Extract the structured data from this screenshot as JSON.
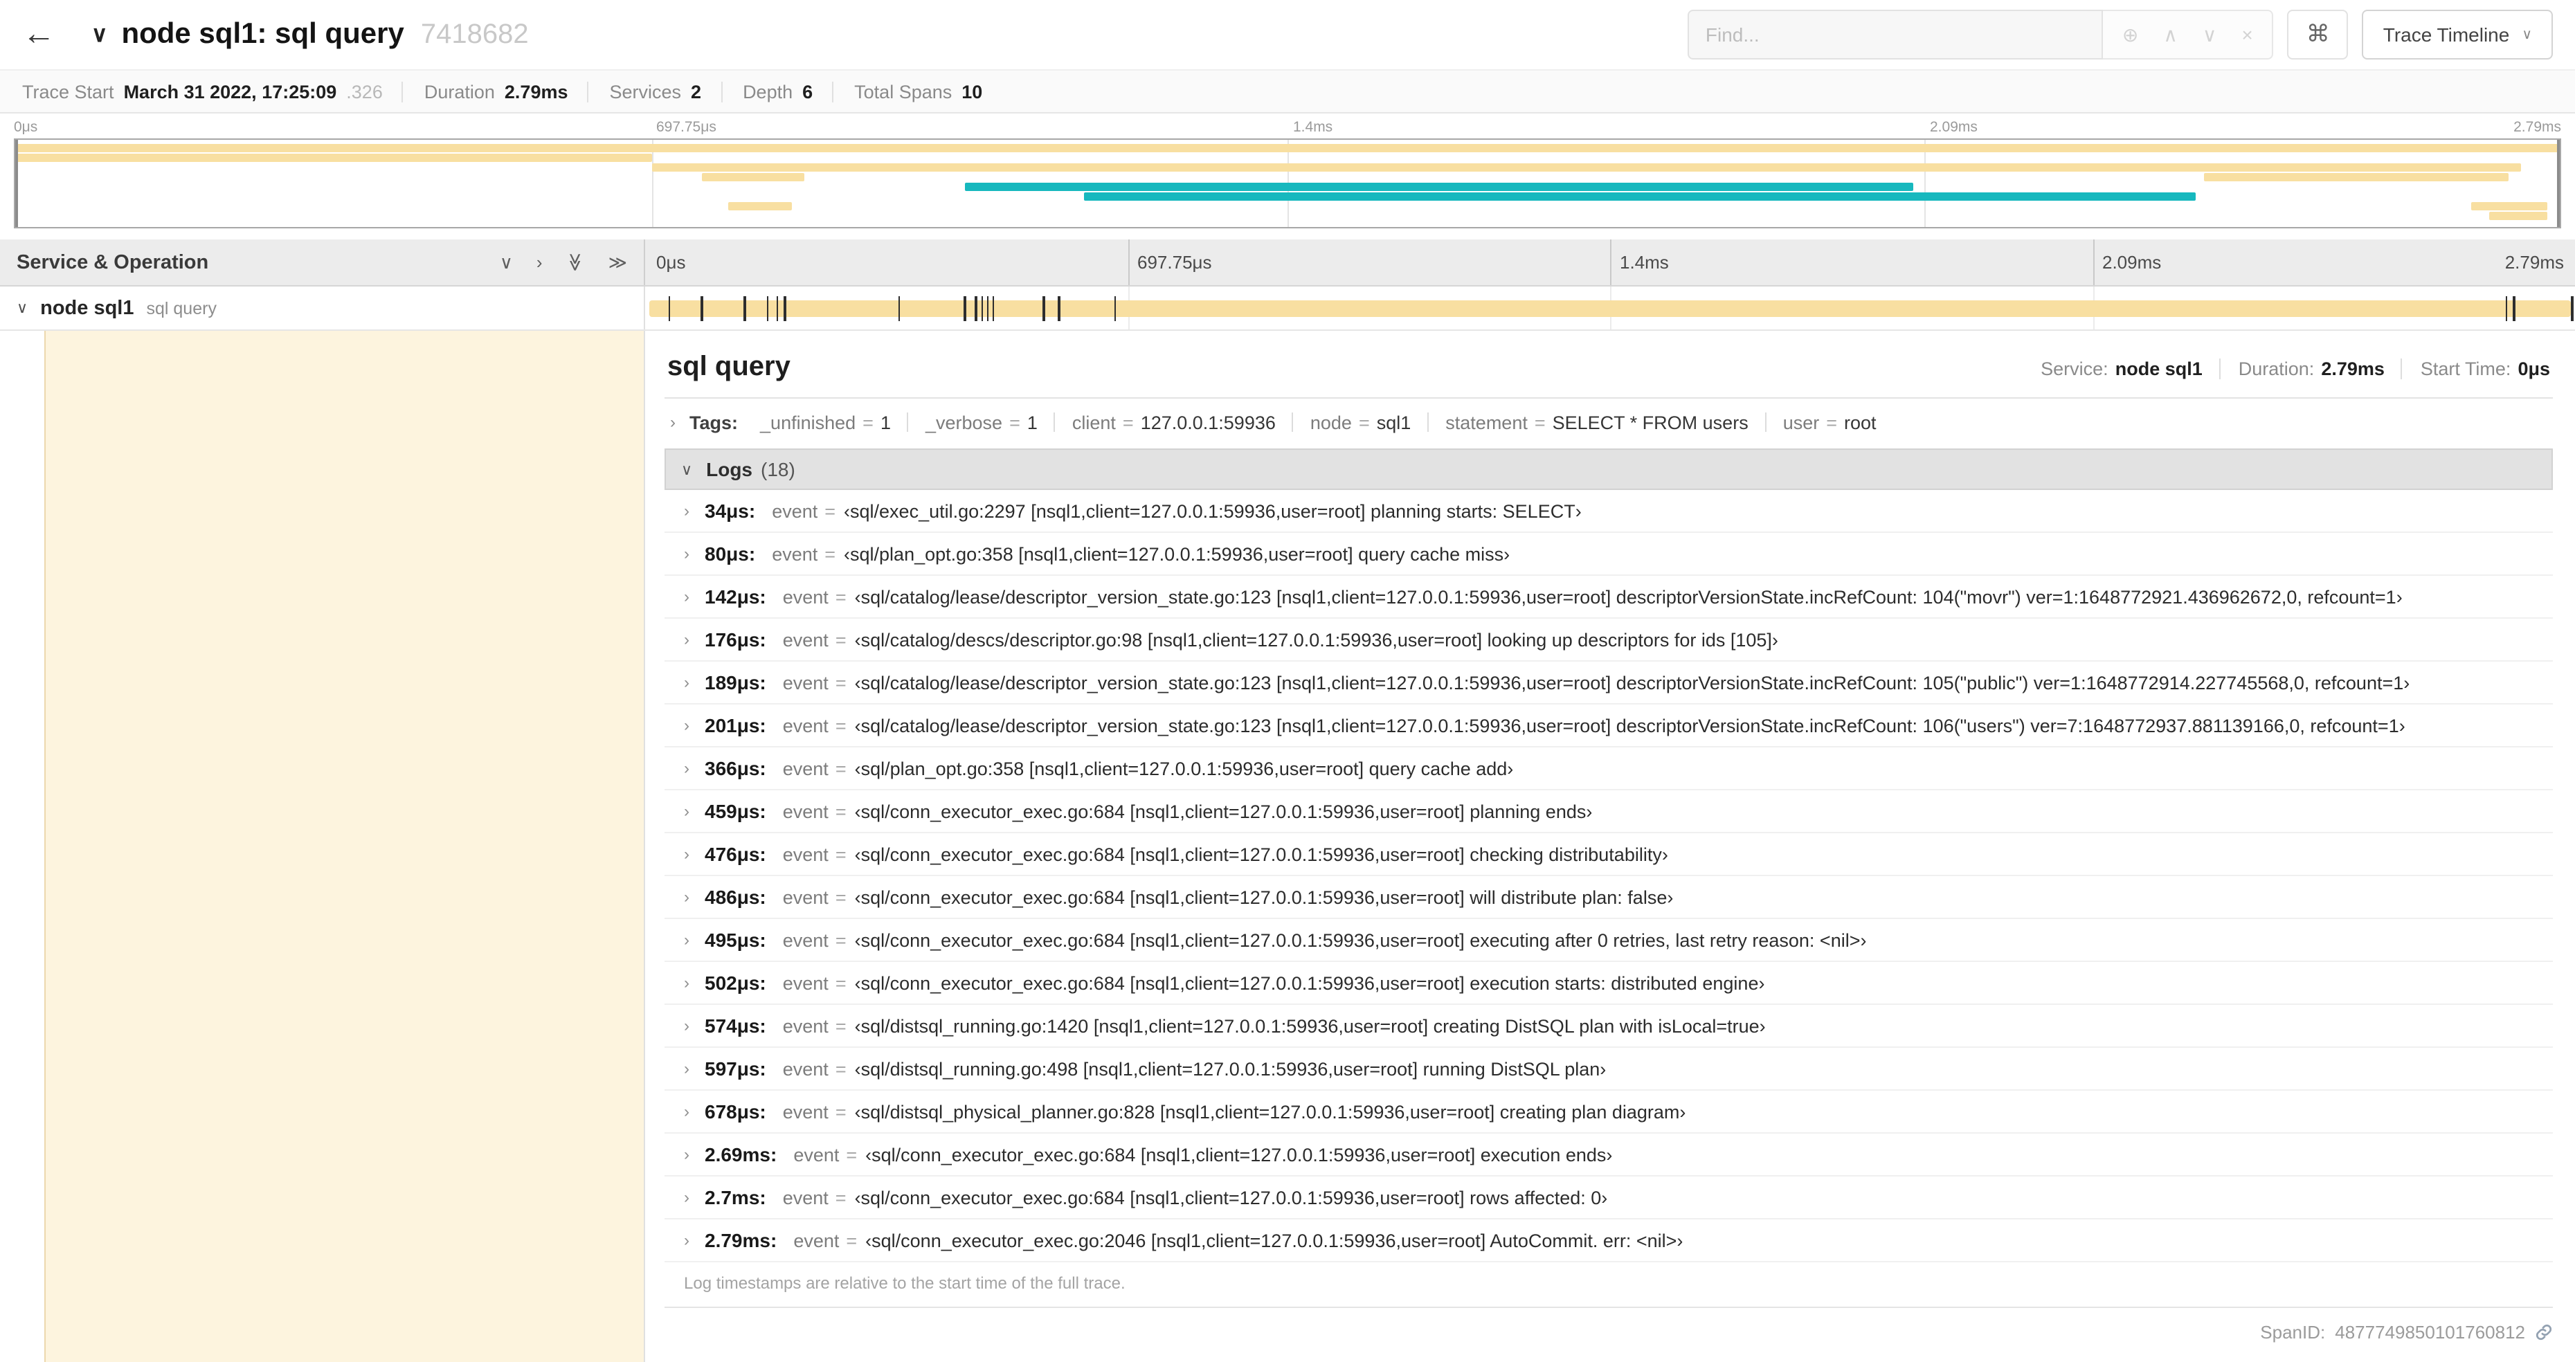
{
  "colors": {
    "span_tan": "#F8DFA1",
    "span_teal": "#17B8BE",
    "detail_row_fill": "rgba(248,223,161,0.35)"
  },
  "icons": {
    "back": "←",
    "title_collapser": "∨",
    "find_zoom": "⊕",
    "find_prev": "∧",
    "find_next": "∨",
    "find_clear": "×",
    "shortcuts": "⌘",
    "view_chevron": "∨",
    "collapse_one": "∨",
    "expand_one": "›",
    "collapse_all": "≫",
    "expand_all": "≫",
    "row_collapser": "∨",
    "tags_chevron": "›",
    "logs_chevron": "∨",
    "log_chevron": "›"
  },
  "header": {
    "title": "node sql1: sql query",
    "trace_id": "7418682",
    "find": {
      "placeholder": "Find..."
    },
    "view_button": {
      "label": "Trace Timeline"
    }
  },
  "trace_info": [
    {
      "label": "Trace Start",
      "value": "March 31 2022, 17:25:09",
      "suffix": ".326"
    },
    {
      "label": "Duration",
      "value": "2.79ms"
    },
    {
      "label": "Services",
      "value": "2"
    },
    {
      "label": "Depth",
      "value": "6"
    },
    {
      "label": "Total Spans",
      "value": "10"
    }
  ],
  "minimap": {
    "axis_labels": [
      {
        "text": "0μs",
        "pct": 0
      },
      {
        "text": "697.75μs",
        "pct": 25
      },
      {
        "text": "1.4ms",
        "pct": 50
      },
      {
        "text": "2.09ms",
        "pct": 75
      },
      {
        "text": "2.79ms",
        "pct": 100
      }
    ],
    "gridlines_pct": [
      25,
      50,
      75
    ],
    "bars": [
      {
        "row": 0,
        "start_pct": 0,
        "width_pct": 100,
        "color": "tan"
      },
      {
        "row": 1,
        "start_pct": 0,
        "width_pct": 25,
        "color": "tan"
      },
      {
        "row": 2,
        "start_pct": 25,
        "width_pct": 73.5,
        "color": "tan"
      },
      {
        "row": 3,
        "start_pct": 27,
        "width_pct": 4,
        "color": "tan"
      },
      {
        "row": 3,
        "start_pct": 86,
        "width_pct": 12,
        "color": "tan"
      },
      {
        "row": 4,
        "start_pct": 37.3,
        "width_pct": 37.3,
        "color": "teal"
      },
      {
        "row": 5,
        "start_pct": 42,
        "width_pct": 43.7,
        "color": "teal"
      },
      {
        "row": 6,
        "start_pct": 28,
        "width_pct": 2.5,
        "color": "tan"
      },
      {
        "row": 6,
        "start_pct": 96.5,
        "width_pct": 3,
        "color": "tan"
      },
      {
        "row": 7,
        "start_pct": 97.2,
        "width_pct": 2.3,
        "color": "tan"
      }
    ]
  },
  "timeline": {
    "left_header": "Service & Operation",
    "columns": [
      {
        "text": "0μs",
        "pct": 0
      },
      {
        "text": "697.75μs",
        "pct": 25
      },
      {
        "text": "1.4ms",
        "pct": 50
      },
      {
        "text": "2.09ms",
        "pct": 75
      },
      {
        "text": "2.79ms",
        "pct": 100
      }
    ],
    "row": {
      "service": "node sql1",
      "operation": "sql query",
      "bar_start_pct": 0.2,
      "bar_width_pct": 99.6,
      "tick_pcts": [
        1.2,
        2.9,
        5.1,
        6.3,
        6.8,
        7.2,
        13.1,
        16.5,
        17.1,
        17.4,
        17.7,
        18.0,
        20.6,
        21.4,
        24.3,
        96.4,
        96.8,
        99.8
      ]
    }
  },
  "detail": {
    "title": "sql query",
    "meta": [
      {
        "label": "Service:",
        "value": "node sql1"
      },
      {
        "label": "Duration:",
        "value": "2.79ms"
      },
      {
        "label": "Start Time:",
        "value": "0μs"
      }
    ],
    "tags": {
      "label": "Tags:",
      "pairs": [
        {
          "key": "_unfinished",
          "value": "1"
        },
        {
          "key": "_verbose",
          "value": "1"
        },
        {
          "key": "client",
          "value": "127.0.0.1:59936"
        },
        {
          "key": "node",
          "value": "sql1"
        },
        {
          "key": "statement",
          "value": "SELECT * FROM users"
        },
        {
          "key": "user",
          "value": "root"
        }
      ]
    },
    "logs": {
      "label": "Logs",
      "count": "(18)",
      "entries": [
        {
          "time": "34μs:",
          "key": "event",
          "value": "‹sql/exec_util.go:2297 [nsql1,client=127.0.0.1:59936,user=root] planning starts: SELECT›"
        },
        {
          "time": "80μs:",
          "key": "event",
          "value": "‹sql/plan_opt.go:358 [nsql1,client=127.0.0.1:59936,user=root] query cache miss›"
        },
        {
          "time": "142μs:",
          "key": "event",
          "value": "‹sql/catalog/lease/descriptor_version_state.go:123 [nsql1,client=127.0.0.1:59936,user=root] descriptorVersionState.incRefCount: 104(\"movr\") ver=1:1648772921.436962672,0, refcount=1›"
        },
        {
          "time": "176μs:",
          "key": "event",
          "value": "‹sql/catalog/descs/descriptor.go:98 [nsql1,client=127.0.0.1:59936,user=root] looking up descriptors for ids [105]›"
        },
        {
          "time": "189μs:",
          "key": "event",
          "value": "‹sql/catalog/lease/descriptor_version_state.go:123 [nsql1,client=127.0.0.1:59936,user=root] descriptorVersionState.incRefCount: 105(\"public\") ver=1:1648772914.227745568,0, refcount=1›"
        },
        {
          "time": "201μs:",
          "key": "event",
          "value": "‹sql/catalog/lease/descriptor_version_state.go:123 [nsql1,client=127.0.0.1:59936,user=root] descriptorVersionState.incRefCount: 106(\"users\") ver=7:1648772937.881139166,0, refcount=1›"
        },
        {
          "time": "366μs:",
          "key": "event",
          "value": "‹sql/plan_opt.go:358 [nsql1,client=127.0.0.1:59936,user=root] query cache add›"
        },
        {
          "time": "459μs:",
          "key": "event",
          "value": "‹sql/conn_executor_exec.go:684 [nsql1,client=127.0.0.1:59936,user=root] planning ends›"
        },
        {
          "time": "476μs:",
          "key": "event",
          "value": "‹sql/conn_executor_exec.go:684 [nsql1,client=127.0.0.1:59936,user=root] checking distributability›"
        },
        {
          "time": "486μs:",
          "key": "event",
          "value": "‹sql/conn_executor_exec.go:684 [nsql1,client=127.0.0.1:59936,user=root] will distribute plan: false›"
        },
        {
          "time": "495μs:",
          "key": "event",
          "value": "‹sql/conn_executor_exec.go:684 [nsql1,client=127.0.0.1:59936,user=root] executing after 0 retries, last retry reason: <nil>›"
        },
        {
          "time": "502μs:",
          "key": "event",
          "value": "‹sql/conn_executor_exec.go:684 [nsql1,client=127.0.0.1:59936,user=root] execution starts: distributed engine›"
        },
        {
          "time": "574μs:",
          "key": "event",
          "value": "‹sql/distsql_running.go:1420 [nsql1,client=127.0.0.1:59936,user=root] creating DistSQL plan with isLocal=true›"
        },
        {
          "time": "597μs:",
          "key": "event",
          "value": "‹sql/distsql_running.go:498 [nsql1,client=127.0.0.1:59936,user=root] running DistSQL plan›"
        },
        {
          "time": "678μs:",
          "key": "event",
          "value": "‹sql/distsql_physical_planner.go:828 [nsql1,client=127.0.0.1:59936,user=root] creating plan diagram›"
        },
        {
          "time": "2.69ms:",
          "key": "event",
          "value": "‹sql/conn_executor_exec.go:684 [nsql1,client=127.0.0.1:59936,user=root] execution ends›"
        },
        {
          "time": "2.7ms:",
          "key": "event",
          "value": "‹sql/conn_executor_exec.go:684 [nsql1,client=127.0.0.1:59936,user=root] rows affected: 0›"
        },
        {
          "time": "2.79ms:",
          "key": "event",
          "value": "‹sql/conn_executor_exec.go:2046 [nsql1,client=127.0.0.1:59936,user=root] AutoCommit. err: <nil>›"
        }
      ],
      "footnote": "Log timestamps are relative to the start time of the full trace."
    },
    "span_id": {
      "label": "SpanID:",
      "value": "4877749850101760812"
    }
  }
}
